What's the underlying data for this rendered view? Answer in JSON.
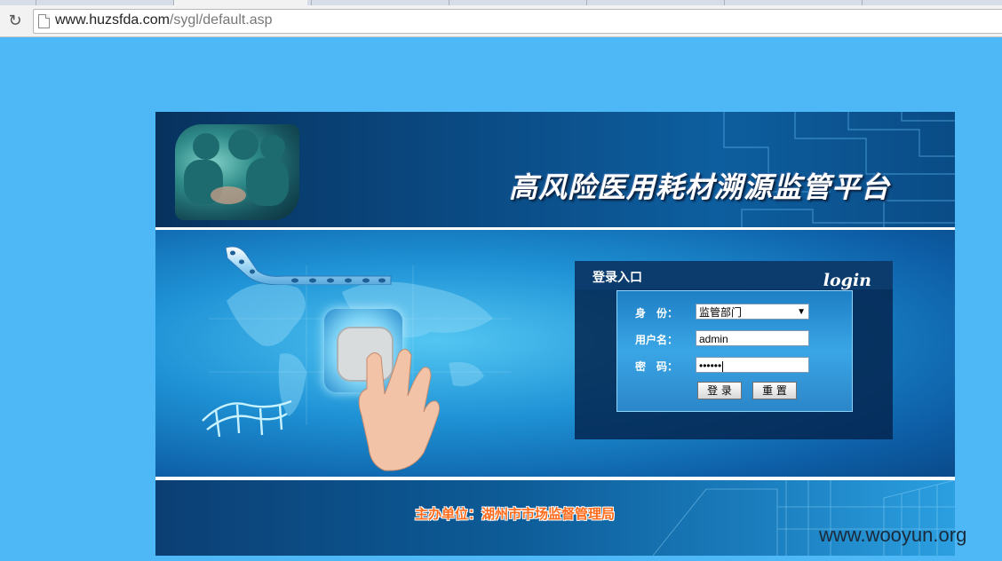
{
  "browser": {
    "url_host": "www.huzsfda.com",
    "url_path": "/sygl/default.asp"
  },
  "site": {
    "title": "高风险医用耗材溯源监管平台"
  },
  "login": {
    "title": "登录入口",
    "script_label": "login",
    "identity_label": "身　份：",
    "identity_value": "监管部门",
    "username_label": "用户名：",
    "username_value": "admin",
    "password_label": "密　码：",
    "password_value": "••••••",
    "submit_label": "登 录",
    "reset_label": "重 置"
  },
  "footer": {
    "host_label": "主办单位：湖州市市场监督管理局"
  },
  "watermark": "www.wooyun.org",
  "colors": {
    "page_background": "#4db8f5",
    "footer_text": "#ff6a1a"
  }
}
